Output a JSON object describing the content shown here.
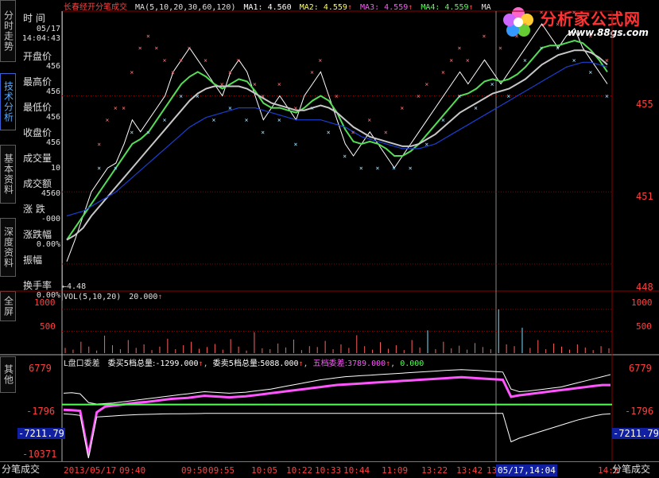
{
  "header": {
    "stock_name": "长春经开",
    "mode": "分笔成交",
    "ma_params": "MA(5,10,20,30,60,120)",
    "ma1": "MA1: 4.560",
    "ma2": "MA2: 4.559",
    "ma3": "MA3: 4.559",
    "ma4": "MA4: 4.559",
    "ma5_trunc": "MA",
    "colors": {
      "ma1": "#ffffff",
      "ma2": "#ffff55",
      "ma3": "#ff55ff",
      "ma4": "#55ff55"
    }
  },
  "logo": {
    "title": "分析家公式网",
    "url": "www.88gs.com"
  },
  "sidebar": {
    "tabs": [
      {
        "label": "分时走势"
      },
      {
        "label": "技术分析"
      },
      {
        "label": "基本资料"
      },
      {
        "label": "深度资料"
      },
      {
        "label": "全屏"
      },
      {
        "label": "其他"
      }
    ],
    "bottom_label": "分笔成交"
  },
  "info": {
    "time_label": "时 间",
    "date": "05/17",
    "time": "14:04:43",
    "open_label": "开盘价",
    "open_val": "456",
    "high_label": "最高价",
    "high_val": "456",
    "low_label": "最低价",
    "low_val": "456",
    "close_label": "收盘价",
    "close_val": "456",
    "vol_label": "成交量",
    "vol_val": "10",
    "amt_label": "成交额",
    "amt_val": "4560",
    "chg_label": "涨 跌",
    "chg_val": "-000",
    "chgp_label": "涨跌幅",
    "chgp_val": "0.00%",
    "amp_label": "振幅",
    "turn_label": "换手率",
    "turn_val": "0.00%"
  },
  "price_panel": {
    "low_marker": "←4.48",
    "right_axis": [
      "455",
      "451",
      "448"
    ],
    "gridlines": [
      455,
      451,
      448
    ]
  },
  "vol_panel": {
    "label": "VOL(5,10,20)",
    "value": "20.000",
    "axis": [
      "1000",
      "500"
    ]
  },
  "ind_panel": {
    "label": "L盘口委差",
    "buy_label": "委买5档总量:",
    "buy_val": "-1299.000",
    "sell_label": "委卖5档总量:",
    "sell_val": "5088.000",
    "diff_label": "五档委差:",
    "diff_val": "3789.000",
    "zero_val": "0.000",
    "axis": [
      "6779",
      "-1796",
      "-7211.79",
      "-10371"
    ],
    "colors": {
      "buy": "#ffffff",
      "diff": "#ff55ff",
      "zero": "#55ff55"
    }
  },
  "time_axis": {
    "labels": [
      "2013/05/17",
      "09:40",
      "09:50",
      "09:55",
      "10:05",
      "10:22",
      "10:33",
      "10:44",
      "11:09",
      "13:22",
      "13:42",
      "13",
      "05/17,14:04",
      "14:5"
    ],
    "cursor_label": "05/17,14:04"
  },
  "chart_data": {
    "type": "line",
    "title": "长春经开 分笔成交",
    "price_ylim": [
      4.47,
      4.58
    ],
    "price_ticks": [
      4.55,
      4.51,
      4.48
    ],
    "price_series": [
      {
        "name": "price",
        "values": [
          4.481,
          4.49,
          4.5,
          4.51,
          4.515,
          4.52,
          4.522,
          4.53,
          4.54,
          4.535,
          4.54,
          4.545,
          4.55,
          4.56,
          4.565,
          4.57,
          4.565,
          4.56,
          4.555,
          4.55,
          4.56,
          4.565,
          4.56,
          4.55,
          4.54,
          4.545,
          4.55,
          4.545,
          4.54,
          4.55,
          4.555,
          4.56,
          4.55,
          4.54,
          4.53,
          4.525,
          4.53,
          4.535,
          4.53,
          4.525,
          4.52,
          4.525,
          4.53,
          4.535,
          4.54,
          4.545,
          4.55,
          4.555,
          4.56,
          4.555,
          4.56,
          4.565,
          4.56,
          4.555,
          4.56,
          4.565,
          4.57,
          4.575,
          4.58,
          4.575,
          4.57,
          4.575,
          4.578,
          4.57,
          4.565,
          4.56,
          4.555
        ]
      },
      {
        "name": "MA1",
        "values": [
          4.49,
          4.495,
          4.5,
          4.505,
          4.51,
          4.515,
          4.52,
          4.525,
          4.53,
          4.532,
          4.535,
          4.54,
          4.545,
          4.55,
          4.555,
          4.558,
          4.56,
          4.558,
          4.555,
          4.553,
          4.555,
          4.557,
          4.556,
          4.552,
          4.547,
          4.545,
          4.545,
          4.544,
          4.543,
          4.545,
          4.548,
          4.55,
          4.548,
          4.543,
          4.536,
          4.531,
          4.53,
          4.531,
          4.53,
          4.528,
          4.525,
          4.525,
          4.527,
          4.53,
          4.534,
          4.538,
          4.542,
          4.546,
          4.55,
          4.551,
          4.553,
          4.556,
          4.557,
          4.556,
          4.557,
          4.559,
          4.562,
          4.566,
          4.57,
          4.571,
          4.571,
          4.572,
          4.573,
          4.572,
          4.569,
          4.565,
          4.56
        ]
      },
      {
        "name": "MA2",
        "values": [
          4.49,
          4.492,
          4.495,
          4.5,
          4.504,
          4.508,
          4.512,
          4.516,
          4.52,
          4.524,
          4.528,
          4.532,
          4.536,
          4.54,
          4.544,
          4.548,
          4.551,
          4.553,
          4.554,
          4.554,
          4.554,
          4.554,
          4.553,
          4.551,
          4.549,
          4.547,
          4.546,
          4.545,
          4.544,
          4.544,
          4.545,
          4.546,
          4.545,
          4.543,
          4.54,
          4.537,
          4.535,
          4.533,
          4.532,
          4.531,
          4.53,
          4.529,
          4.529,
          4.53,
          4.532,
          4.534,
          4.537,
          4.54,
          4.543,
          4.545,
          4.547,
          4.549,
          4.551,
          4.552,
          4.553,
          4.555,
          4.557,
          4.56,
          4.563,
          4.565,
          4.567,
          4.568,
          4.569,
          4.569,
          4.568,
          4.566,
          4.563
        ]
      },
      {
        "name": "MA3",
        "values": [
          4.5,
          4.501,
          4.502,
          4.504,
          4.506,
          4.508,
          4.51,
          4.513,
          4.516,
          4.519,
          4.522,
          4.525,
          4.528,
          4.531,
          4.534,
          4.537,
          4.539,
          4.541,
          4.542,
          4.543,
          4.544,
          4.545,
          4.545,
          4.545,
          4.544,
          4.543,
          4.542,
          4.541,
          4.54,
          4.54,
          4.54,
          4.54,
          4.539,
          4.538,
          4.537,
          4.535,
          4.533,
          4.532,
          4.531,
          4.53,
          4.529,
          4.528,
          4.528,
          4.528,
          4.529,
          4.53,
          4.532,
          4.534,
          4.536,
          4.538,
          4.54,
          4.542,
          4.544,
          4.546,
          4.548,
          4.55,
          4.552,
          4.554,
          4.556,
          4.558,
          4.56,
          4.562,
          4.563,
          4.564,
          4.564,
          4.563,
          4.562
        ]
      },
      {
        "name": "upper_marks",
        "values": [
          null,
          null,
          null,
          null,
          4.53,
          4.54,
          4.545,
          4.545,
          4.56,
          4.57,
          4.575,
          4.57,
          4.565,
          4.56,
          4.565,
          4.57,
          null,
          4.565,
          null,
          4.555,
          4.56,
          4.565,
          null,
          4.555,
          4.55,
          null,
          4.555,
          null,
          4.545,
          null,
          4.56,
          4.565,
          null,
          4.55,
          null,
          4.535,
          null,
          4.54,
          null,
          4.535,
          null,
          4.545,
          null,
          4.55,
          4.555,
          null,
          4.56,
          4.565,
          4.57,
          4.565,
          null,
          4.575,
          null,
          4.57,
          null,
          4.575,
          4.58,
          null,
          4.585,
          null,
          4.58,
          null,
          4.585,
          null,
          4.575,
          null,
          4.565
        ]
      },
      {
        "name": "lower_marks",
        "values": [
          null,
          null,
          null,
          null,
          4.52,
          null,
          4.52,
          null,
          4.535,
          null,
          4.535,
          null,
          4.54,
          null,
          4.55,
          null,
          4.55,
          null,
          4.54,
          null,
          4.545,
          null,
          4.54,
          null,
          4.535,
          null,
          4.54,
          null,
          4.53,
          null,
          4.545,
          null,
          4.535,
          null,
          4.525,
          null,
          4.52,
          null,
          4.52,
          null,
          4.52,
          null,
          4.52,
          null,
          4.53,
          null,
          4.54,
          null,
          4.55,
          null,
          4.545,
          null,
          4.555,
          null,
          4.55,
          null,
          4.565,
          null,
          4.57,
          null,
          4.57,
          null,
          4.565,
          null,
          4.56,
          null,
          4.55
        ]
      }
    ],
    "volume_ylim": [
      0,
      1200
    ],
    "volume_ticks": [
      1000,
      500
    ],
    "volume_values": [
      120,
      80,
      260,
      150,
      60,
      400,
      180,
      90,
      300,
      120,
      200,
      70,
      150,
      330,
      90,
      180,
      260,
      100,
      140,
      210,
      80,
      320,
      150,
      60,
      480,
      110,
      90,
      220,
      130,
      310,
      70,
      160,
      140,
      280,
      90,
      200,
      120,
      410,
      160,
      80,
      250,
      100,
      180,
      70,
      300,
      130,
      520,
      90,
      260,
      110,
      170,
      80,
      230,
      140,
      90,
      1000,
      200,
      160,
      580,
      120,
      300,
      90,
      220,
      150,
      80,
      200,
      130,
      70,
      160,
      110
    ],
    "volume_highlight_indices": [
      46,
      55,
      58
    ],
    "indicator_ylim": [
      -10371,
      7500
    ],
    "indicator_ticks": [
      6779,
      -1796,
      -7211.79,
      -10371
    ],
    "indicator_series": [
      {
        "name": "委买5档总量",
        "values": [
          2200,
          2300,
          2100,
          400,
          100,
          200,
          300,
          500,
          700,
          900,
          1100,
          1300,
          1500,
          1700,
          1900,
          2100,
          2300,
          2500,
          2400,
          2300,
          2200,
          2300,
          2400,
          2600,
          2800,
          3000,
          3300,
          3600,
          3900,
          4200,
          4500,
          4800,
          5000,
          5200,
          5400,
          5500,
          5600,
          5700,
          5800,
          5900,
          6000,
          6100,
          6200,
          6300,
          6400,
          6500,
          6600,
          6700,
          6779,
          6700,
          6600,
          6500,
          6400,
          6300,
          3000,
          2500,
          2600,
          2800,
          3000,
          3200,
          3400,
          3800,
          4200,
          4600,
          5000,
          5400,
          5800
        ]
      },
      {
        "name": "五档委差",
        "values": [
          -1000,
          -1100,
          -1200,
          -9800,
          -1500,
          -400,
          -200,
          0,
          200,
          400,
          500,
          700,
          900,
          1100,
          1200,
          1300,
          1500,
          1700,
          1600,
          1500,
          1400,
          1500,
          1600,
          1800,
          2000,
          2200,
          2400,
          2600,
          2800,
          3000,
          3200,
          3400,
          3600,
          3800,
          3900,
          4000,
          4100,
          4200,
          4300,
          4400,
          4500,
          4600,
          4700,
          4800,
          4900,
          5000,
          5100,
          5200,
          5300,
          5200,
          5100,
          5000,
          4900,
          4800,
          1500,
          1800,
          2000,
          2200,
          2400,
          2600,
          2800,
          3000,
          3200,
          3400,
          3600,
          3789,
          3789
        ]
      },
      {
        "name": "委卖5档总量",
        "values": [
          -1796,
          -1900,
          -2100,
          -10371,
          -2400,
          -2300,
          -2200,
          -2100,
          -2000,
          -1950,
          -1900,
          -1850,
          -1800,
          -1796,
          -1780,
          -1760,
          -1740,
          -1720,
          -1700,
          -1700,
          -1700,
          -1700,
          -1700,
          -1700,
          -1700,
          -1700,
          -1700,
          -1700,
          -1700,
          -1700,
          -1700,
          -1700,
          -1700,
          -1700,
          -1700,
          -1700,
          -1700,
          -1700,
          -1700,
          -1700,
          -1700,
          -1700,
          -1700,
          -1700,
          -1700,
          -1700,
          -1700,
          -1700,
          -1700,
          -1700,
          -1700,
          -1700,
          -1700,
          -1700,
          -7211.79,
          -6500,
          -6000,
          -5500,
          -5000,
          -4500,
          -4000,
          -3500,
          -3000,
          -2600,
          -2200,
          -1900,
          -1796
        ]
      },
      {
        "name": "0",
        "values": [
          0
        ]
      }
    ]
  }
}
